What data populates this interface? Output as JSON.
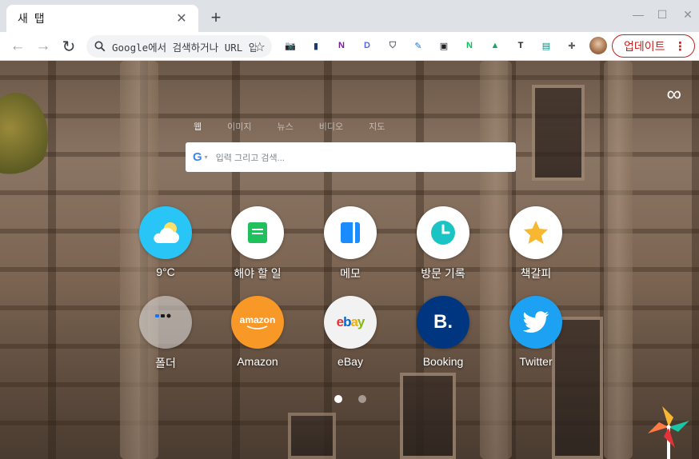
{
  "tab": {
    "title": "새 탭",
    "close_glyph": "✕"
  },
  "tabstrip": {
    "new_tab_glyph": "+",
    "minimize_glyph": "—",
    "maximize_glyph": "☐",
    "close_glyph": "✕"
  },
  "toolbar": {
    "back_glyph": "←",
    "forward_glyph": "→",
    "reload_glyph": "↻",
    "omnibox_text": "Google에서 검색하거나 URL 입력",
    "star_glyph": "☆",
    "extensions": [
      {
        "name": "camera-icon",
        "glyph": "📷",
        "color": "#5f6368"
      },
      {
        "name": "chart-extension-icon",
        "glyph": "▮",
        "color": "#1a3a6e"
      },
      {
        "name": "onenote-icon",
        "glyph": "N",
        "color": "#7719aa"
      },
      {
        "name": "d-extension-icon",
        "glyph": "D",
        "color": "#4f6bed"
      },
      {
        "name": "shield-icon",
        "glyph": "⛉",
        "color": "#5f6368"
      },
      {
        "name": "pen-extension-icon",
        "glyph": "✎",
        "color": "#1a73e8"
      },
      {
        "name": "picture-in-picture-icon",
        "glyph": "▣",
        "color": "#202124"
      },
      {
        "name": "naver-icon",
        "glyph": "N",
        "color": "#03c75a"
      },
      {
        "name": "google-drive-icon",
        "glyph": "▲",
        "color": "#1fa463"
      },
      {
        "name": "text-t-icon",
        "glyph": "T",
        "color": "#202124"
      },
      {
        "name": "save-floppy-icon",
        "glyph": "▤",
        "color": "#00897b"
      },
      {
        "name": "puzzle-extensions-icon",
        "glyph": "✚",
        "color": "#5f6368"
      }
    ],
    "update_label": "업데이트",
    "menu_glyph": "⋮"
  },
  "content": {
    "infinity_glyph": "∞",
    "search_tabs": [
      "웹",
      "이미지",
      "뉴스",
      "비디오",
      "지도"
    ],
    "search_logo": "G",
    "search_caret": "▾",
    "search_placeholder": "입력 그리고 검색...",
    "shortcuts_row1": [
      {
        "label": "9°C",
        "name": "weather"
      },
      {
        "label": "해야 할 일",
        "name": "todo"
      },
      {
        "label": "메모",
        "name": "memo"
      },
      {
        "label": "방문 기록",
        "name": "history"
      },
      {
        "label": "책갈피",
        "name": "bookmarks"
      }
    ],
    "shortcuts_row2": [
      {
        "label": "폴더",
        "name": "folder"
      },
      {
        "label": "Amazon",
        "name": "amazon"
      },
      {
        "label": "eBay",
        "name": "ebay"
      },
      {
        "label": "Booking",
        "name": "booking"
      },
      {
        "label": "Twitter",
        "name": "twitter"
      }
    ],
    "amazon_logo_text": "amazon",
    "ebay_letters": [
      "e",
      "b",
      "a",
      "y"
    ],
    "booking_letter": "B.",
    "page_count": 2,
    "active_page": 1
  },
  "colors": {
    "weather_bg": "#29c5f6",
    "todo_green": "#20c05c",
    "memo_blue": "#1a8cff",
    "history_teal": "#1bc4c4",
    "bookmark_star": "#f7b731",
    "amazon_bg": "#f89927",
    "booking_bg": "#003580",
    "twitter_bg": "#1da1f2",
    "update_red": "#c5221f"
  }
}
